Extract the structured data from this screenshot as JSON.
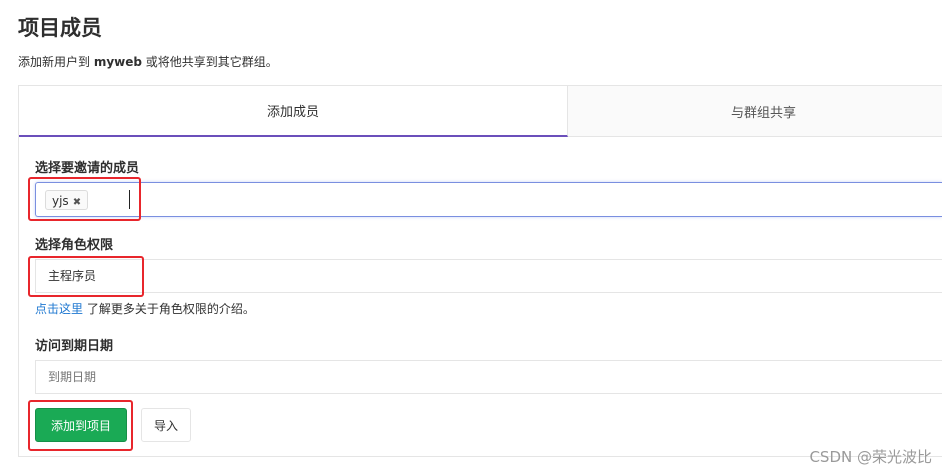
{
  "page": {
    "title": "项目成员",
    "subtitle_prefix": "添加新用户到 ",
    "subtitle_project": "myweb",
    "subtitle_suffix": " 或将他共享到其它群组。"
  },
  "tabs": [
    {
      "label": "添加成员",
      "active": true
    },
    {
      "label": "与群组共享",
      "active": false
    }
  ],
  "form": {
    "members_label": "选择要邀请的成员",
    "members_tokens": [
      "yjs"
    ],
    "token_remove_glyph": "✖",
    "role_label": "选择角色权限",
    "role_value": "主程序员",
    "help_link_text": "点击这里",
    "help_text": " 了解更多关于角色权限的介绍。",
    "expiry_label": "访问到期日期",
    "expiry_placeholder": "到期日期",
    "submit_label": "添加到项目",
    "import_label": "导入"
  },
  "watermark": "CSDN @荣光波比",
  "colors": {
    "accent_tab_border": "#6b4fbb",
    "submit_green": "#1aaa55",
    "link_blue": "#1f78d1",
    "highlight_red": "#e8262c"
  }
}
